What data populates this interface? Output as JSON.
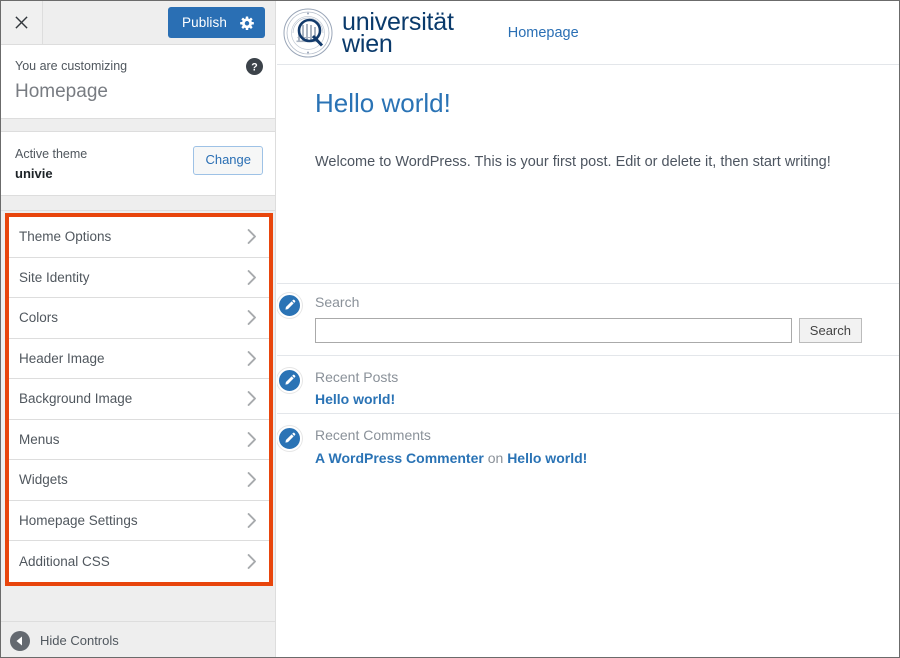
{
  "customizer": {
    "close_label": "Close",
    "publish_label": "Publish",
    "publish_gear_icon": "gear-icon",
    "kicker": "You are customizing",
    "document_title": "Homepage",
    "help_icon": "help-circle-icon",
    "theme_kicker": "Active theme",
    "theme_name": "univie",
    "change_label": "Change",
    "highlight_color": "#e8450c",
    "accent_color": "#2a6fb4",
    "sections": [
      {
        "label": "Theme Options"
      },
      {
        "label": "Site Identity"
      },
      {
        "label": "Colors"
      },
      {
        "label": "Header Image"
      },
      {
        "label": "Background Image"
      },
      {
        "label": "Menus"
      },
      {
        "label": "Widgets"
      },
      {
        "label": "Homepage Settings"
      },
      {
        "label": "Additional CSS"
      }
    ],
    "footer_label": "Hide Controls",
    "footer_icon": "collapse-left-icon"
  },
  "preview": {
    "site": {
      "logo_icon": "university-seal-icon",
      "wordmark_line1": "universität",
      "wordmark_line2": "wien",
      "brand_color": "#0a3a6b",
      "nav": [
        {
          "label": "Homepage"
        }
      ]
    },
    "article": {
      "title": "Hello world!",
      "body": "Welcome to WordPress. This is your first post. Edit or delete it, then start writing!"
    },
    "widgets": {
      "search": {
        "edit_icon": "pencil-edit-icon",
        "title": "Search",
        "input_value": "",
        "input_placeholder": "",
        "button_label": "Search"
      },
      "recent_posts": {
        "edit_icon": "pencil-edit-icon",
        "title": "Recent Posts",
        "items": [
          {
            "label": "Hello world!"
          }
        ]
      },
      "recent_comments": {
        "edit_icon": "pencil-edit-icon",
        "title": "Recent Comments",
        "author": "A WordPress Commenter",
        "connector": "on",
        "post": "Hello world!"
      }
    }
  }
}
